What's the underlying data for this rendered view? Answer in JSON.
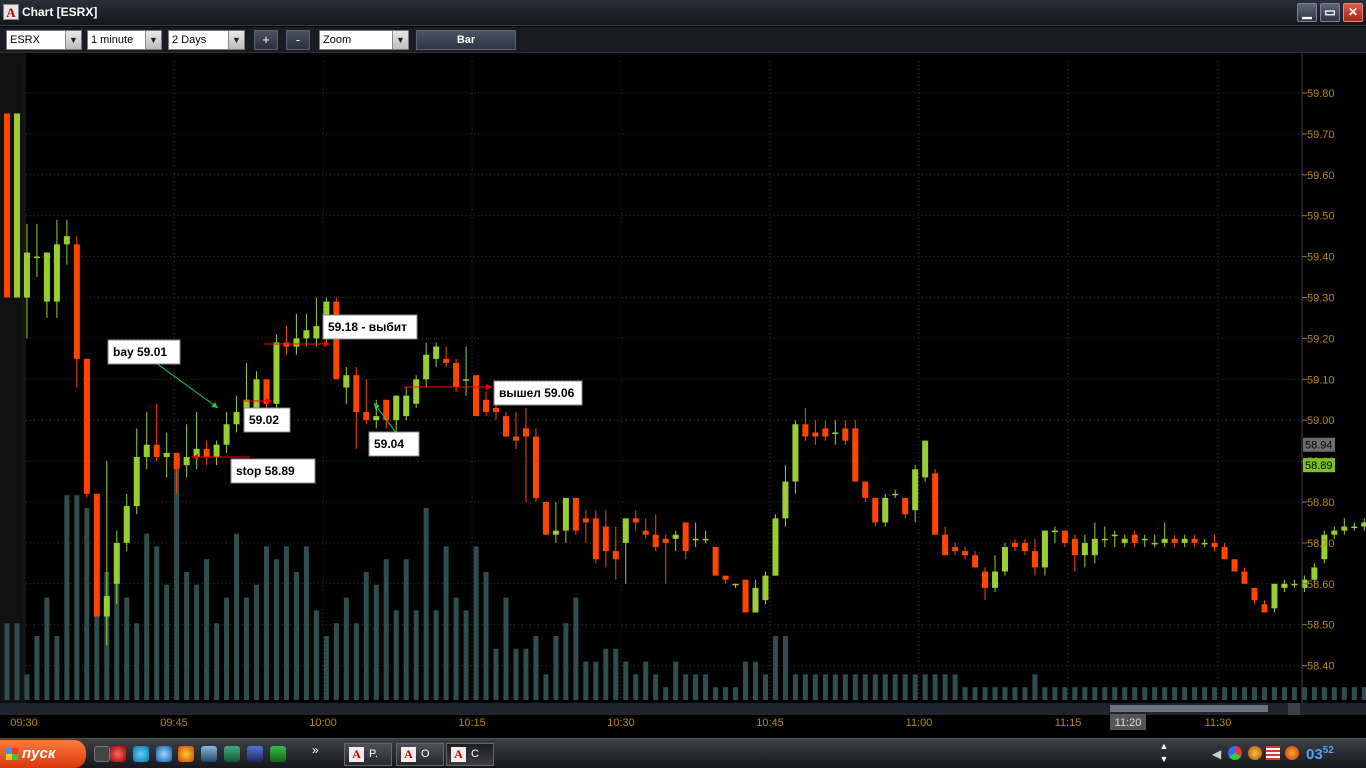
{
  "window": {
    "title": "Chart [ESRX]",
    "minimize": "▁",
    "maximize": "▭",
    "close": "✕"
  },
  "toolbar": {
    "symbol": "ESRX",
    "interval": "1 minute",
    "range": "2 Days",
    "zoom_in": "+",
    "zoom_out": "-",
    "zoom_mode": "Zoom",
    "chart_type_button": "Bar"
  },
  "chart_data": {
    "type": "candlestick",
    "symbol": "ESRX",
    "interval": "1 minute",
    "ylim": [
      58.3,
      59.86
    ],
    "y_ticks": [
      "59.80",
      "59.70",
      "59.60",
      "59.50",
      "59.40",
      "59.30",
      "59.20",
      "59.10",
      "59.00",
      "58.90",
      "58.80",
      "58.70",
      "58.60",
      "58.50",
      "58.40"
    ],
    "x_ticks": [
      "09:30",
      "09:45",
      "10:00",
      "10:15",
      "10:30",
      "10:45",
      "11:00",
      "11:15",
      "11:20",
      "11:30"
    ],
    "cursor_time_label": "11:20",
    "price_labels": [
      {
        "text": "58.94",
        "value": 58.94,
        "color": "#6e6e6e"
      },
      {
        "text": "58.89",
        "value": 58.89,
        "color": "#7cc223"
      }
    ],
    "colors": {
      "up": "#9acd32",
      "down": "#ff4500",
      "volume": "#2f4f4f",
      "grid": "#3a3a3a",
      "axis_text": "#b8860b"
    },
    "candles": [
      {
        "o": 59.75,
        "h": 59.75,
        "l": 59.3,
        "c": 59.3
      },
      {
        "o": 59.3,
        "h": 59.75,
        "l": 59.3,
        "c": 59.75
      },
      {
        "o": 59.3,
        "h": 59.48,
        "l": 59.2,
        "c": 59.41
      },
      {
        "o": 59.4,
        "h": 59.48,
        "l": 59.35,
        "c": 59.4
      },
      {
        "o": 59.29,
        "h": 59.41,
        "l": 59.25,
        "c": 59.41
      },
      {
        "o": 59.29,
        "h": 59.49,
        "l": 59.25,
        "c": 59.43
      },
      {
        "o": 59.43,
        "h": 59.49,
        "l": 59.38,
        "c": 59.45
      },
      {
        "o": 59.43,
        "h": 59.45,
        "l": 59.08,
        "c": 59.15
      },
      {
        "o": 59.15,
        "h": 59.15,
        "l": 58.81,
        "c": 58.82
      },
      {
        "o": 58.82,
        "h": 58.82,
        "l": 58.52,
        "c": 58.52
      },
      {
        "o": 58.52,
        "h": 58.9,
        "l": 58.45,
        "c": 58.57
      },
      {
        "o": 58.6,
        "h": 58.73,
        "l": 58.55,
        "c": 58.7
      },
      {
        "o": 58.7,
        "h": 58.82,
        "l": 58.68,
        "c": 58.79
      },
      {
        "o": 58.79,
        "h": 58.98,
        "l": 58.77,
        "c": 58.91
      },
      {
        "o": 58.91,
        "h": 59.02,
        "l": 58.88,
        "c": 58.94
      },
      {
        "o": 58.94,
        "h": 59.04,
        "l": 58.9,
        "c": 58.91
      },
      {
        "o": 58.91,
        "h": 58.97,
        "l": 58.86,
        "c": 58.92
      },
      {
        "o": 58.92,
        "h": 58.92,
        "l": 58.82,
        "c": 58.88
      },
      {
        "o": 58.89,
        "h": 58.99,
        "l": 58.86,
        "c": 58.91
      },
      {
        "o": 58.91,
        "h": 59.02,
        "l": 58.88,
        "c": 58.93
      },
      {
        "o": 58.93,
        "h": 58.95,
        "l": 58.89,
        "c": 58.91
      },
      {
        "o": 58.91,
        "h": 58.95,
        "l": 58.89,
        "c": 58.94
      },
      {
        "o": 58.94,
        "h": 59.02,
        "l": 58.92,
        "c": 58.99
      },
      {
        "o": 58.99,
        "h": 59.06,
        "l": 58.97,
        "c": 59.02
      },
      {
        "o": 59.02,
        "h": 59.14,
        "l": 58.98,
        "c": 59.05
      },
      {
        "o": 59.02,
        "h": 59.12,
        "l": 59.0,
        "c": 59.1
      },
      {
        "o": 59.1,
        "h": 59.1,
        "l": 59.03,
        "c": 59.04
      },
      {
        "o": 59.04,
        "h": 59.21,
        "l": 59.02,
        "c": 59.19
      },
      {
        "o": 59.19,
        "h": 59.23,
        "l": 59.16,
        "c": 59.18
      },
      {
        "o": 59.18,
        "h": 59.26,
        "l": 59.16,
        "c": 59.2
      },
      {
        "o": 59.2,
        "h": 59.26,
        "l": 59.18,
        "c": 59.22
      },
      {
        "o": 59.2,
        "h": 59.3,
        "l": 59.18,
        "c": 59.23
      },
      {
        "o": 59.2,
        "h": 59.3,
        "l": 59.19,
        "c": 59.29
      },
      {
        "o": 59.29,
        "h": 59.3,
        "l": 59.18,
        "c": 59.1
      },
      {
        "o": 59.08,
        "h": 59.13,
        "l": 59.04,
        "c": 59.11
      },
      {
        "o": 59.11,
        "h": 59.13,
        "l": 58.93,
        "c": 59.02
      },
      {
        "o": 59.02,
        "h": 59.1,
        "l": 58.99,
        "c": 59.0
      },
      {
        "o": 59.0,
        "h": 59.05,
        "l": 58.98,
        "c": 59.01
      },
      {
        "o": 59.05,
        "h": 59.05,
        "l": 58.98,
        "c": 59.0
      },
      {
        "o": 59.0,
        "h": 59.06,
        "l": 58.97,
        "c": 59.06
      },
      {
        "o": 59.01,
        "h": 59.08,
        "l": 59.0,
        "c": 59.06
      },
      {
        "o": 59.04,
        "h": 59.11,
        "l": 59.03,
        "c": 59.1
      },
      {
        "o": 59.1,
        "h": 59.19,
        "l": 59.08,
        "c": 59.16
      },
      {
        "o": 59.15,
        "h": 59.19,
        "l": 59.13,
        "c": 59.18
      },
      {
        "o": 59.15,
        "h": 59.18,
        "l": 59.13,
        "c": 59.14
      },
      {
        "o": 59.14,
        "h": 59.15,
        "l": 59.07,
        "c": 59.08
      },
      {
        "o": 59.1,
        "h": 59.18,
        "l": 59.06,
        "c": 59.1
      },
      {
        "o": 59.11,
        "h": 59.11,
        "l": 59.01,
        "c": 59.01
      },
      {
        "o": 59.05,
        "h": 59.07,
        "l": 59.01,
        "c": 59.02
      },
      {
        "o": 59.03,
        "h": 59.04,
        "l": 59.0,
        "c": 59.02
      },
      {
        "o": 59.01,
        "h": 59.02,
        "l": 58.96,
        "c": 58.96
      },
      {
        "o": 58.96,
        "h": 59.02,
        "l": 58.93,
        "c": 58.95
      },
      {
        "o": 58.98,
        "h": 59.03,
        "l": 58.8,
        "c": 58.96
      },
      {
        "o": 58.96,
        "h": 58.98,
        "l": 58.8,
        "c": 58.81
      },
      {
        "o": 58.8,
        "h": 58.8,
        "l": 58.72,
        "c": 58.72
      },
      {
        "o": 58.72,
        "h": 58.8,
        "l": 58.7,
        "c": 58.73
      },
      {
        "o": 58.73,
        "h": 58.81,
        "l": 58.7,
        "c": 58.81
      },
      {
        "o": 58.81,
        "h": 58.81,
        "l": 58.72,
        "c": 58.73
      },
      {
        "o": 58.76,
        "h": 58.78,
        "l": 58.7,
        "c": 58.75
      },
      {
        "o": 58.76,
        "h": 58.78,
        "l": 58.65,
        "c": 58.66
      },
      {
        "o": 58.74,
        "h": 58.78,
        "l": 58.64,
        "c": 58.68
      },
      {
        "o": 58.68,
        "h": 58.74,
        "l": 58.61,
        "c": 58.66
      },
      {
        "o": 58.7,
        "h": 58.76,
        "l": 58.6,
        "c": 58.76
      },
      {
        "o": 58.76,
        "h": 58.78,
        "l": 58.73,
        "c": 58.75
      },
      {
        "o": 58.73,
        "h": 58.76,
        "l": 58.71,
        "c": 58.72
      },
      {
        "o": 58.72,
        "h": 58.77,
        "l": 58.68,
        "c": 58.69
      },
      {
        "o": 58.71,
        "h": 58.72,
        "l": 58.6,
        "c": 58.7
      },
      {
        "o": 58.71,
        "h": 58.73,
        "l": 58.68,
        "c": 58.72
      },
      {
        "o": 58.75,
        "h": 58.75,
        "l": 58.66,
        "c": 58.68
      },
      {
        "o": 58.71,
        "h": 58.75,
        "l": 58.69,
        "c": 58.71
      },
      {
        "o": 58.71,
        "h": 58.73,
        "l": 58.7,
        "c": 58.71
      },
      {
        "o": 58.69,
        "h": 58.69,
        "l": 58.62,
        "c": 58.62
      },
      {
        "o": 58.62,
        "h": 58.62,
        "l": 58.6,
        "c": 58.61
      },
      {
        "o": 58.6,
        "h": 58.6,
        "l": 58.59,
        "c": 58.6
      },
      {
        "o": 58.61,
        "h": 58.61,
        "l": 58.53,
        "c": 58.53
      },
      {
        "o": 58.53,
        "h": 58.61,
        "l": 58.53,
        "c": 58.59
      },
      {
        "o": 58.56,
        "h": 58.63,
        "l": 58.55,
        "c": 58.62
      },
      {
        "o": 58.62,
        "h": 58.77,
        "l": 58.62,
        "c": 58.76
      },
      {
        "o": 58.76,
        "h": 58.89,
        "l": 58.74,
        "c": 58.85
      },
      {
        "o": 58.85,
        "h": 59.0,
        "l": 58.82,
        "c": 58.99
      },
      {
        "o": 58.99,
        "h": 59.03,
        "l": 58.95,
        "c": 58.96
      },
      {
        "o": 58.97,
        "h": 59.0,
        "l": 58.94,
        "c": 58.96
      },
      {
        "o": 58.98,
        "h": 59.0,
        "l": 58.95,
        "c": 58.96
      },
      {
        "o": 58.97,
        "h": 59.0,
        "l": 58.94,
        "c": 58.97
      },
      {
        "o": 58.98,
        "h": 59.0,
        "l": 58.94,
        "c": 58.95
      },
      {
        "o": 58.98,
        "h": 59.0,
        "l": 58.85,
        "c": 58.85
      },
      {
        "o": 58.85,
        "h": 58.85,
        "l": 58.8,
        "c": 58.81
      },
      {
        "o": 58.81,
        "h": 58.81,
        "l": 58.74,
        "c": 58.75
      },
      {
        "o": 58.75,
        "h": 58.82,
        "l": 58.74,
        "c": 58.81
      },
      {
        "o": 58.82,
        "h": 58.83,
        "l": 58.81,
        "c": 58.82
      },
      {
        "o": 58.81,
        "h": 58.81,
        "l": 58.76,
        "c": 58.77
      },
      {
        "o": 58.78,
        "h": 58.89,
        "l": 58.75,
        "c": 58.88
      },
      {
        "o": 58.86,
        "h": 58.95,
        "l": 58.85,
        "c": 58.95
      },
      {
        "o": 58.87,
        "h": 58.88,
        "l": 58.72,
        "c": 58.72
      },
      {
        "o": 58.72,
        "h": 58.74,
        "l": 58.67,
        "c": 58.67
      },
      {
        "o": 58.69,
        "h": 58.7,
        "l": 58.67,
        "c": 58.68
      },
      {
        "o": 58.68,
        "h": 58.69,
        "l": 58.66,
        "c": 58.67
      },
      {
        "o": 58.67,
        "h": 58.68,
        "l": 58.64,
        "c": 58.64
      },
      {
        "o": 58.63,
        "h": 58.64,
        "l": 58.56,
        "c": 58.59
      },
      {
        "o": 58.59,
        "h": 58.67,
        "l": 58.58,
        "c": 58.63
      },
      {
        "o": 58.63,
        "h": 58.7,
        "l": 58.62,
        "c": 58.69
      },
      {
        "o": 58.7,
        "h": 58.71,
        "l": 58.68,
        "c": 58.69
      },
      {
        "o": 58.7,
        "h": 58.71,
        "l": 58.67,
        "c": 58.68
      },
      {
        "o": 58.68,
        "h": 58.71,
        "l": 58.62,
        "c": 58.64
      },
      {
        "o": 58.64,
        "h": 58.73,
        "l": 58.62,
        "c": 58.73
      },
      {
        "o": 58.73,
        "h": 58.74,
        "l": 58.7,
        "c": 58.73
      },
      {
        "o": 58.73,
        "h": 58.73,
        "l": 58.69,
        "c": 58.7
      },
      {
        "o": 58.71,
        "h": 58.72,
        "l": 58.63,
        "c": 58.67
      },
      {
        "o": 58.67,
        "h": 58.72,
        "l": 58.64,
        "c": 58.7
      },
      {
        "o": 58.67,
        "h": 58.75,
        "l": 58.65,
        "c": 58.71
      },
      {
        "o": 58.71,
        "h": 58.74,
        "l": 58.69,
        "c": 58.71
      },
      {
        "o": 58.72,
        "h": 58.73,
        "l": 58.69,
        "c": 58.72
      },
      {
        "o": 58.7,
        "h": 58.72,
        "l": 58.69,
        "c": 58.71
      },
      {
        "o": 58.72,
        "h": 58.73,
        "l": 58.69,
        "c": 58.7
      },
      {
        "o": 58.71,
        "h": 58.72,
        "l": 58.69,
        "c": 58.71
      },
      {
        "o": 58.7,
        "h": 58.72,
        "l": 58.69,
        "c": 58.7
      },
      {
        "o": 58.7,
        "h": 58.75,
        "l": 58.69,
        "c": 58.71
      },
      {
        "o": 58.71,
        "h": 58.72,
        "l": 58.69,
        "c": 58.7
      },
      {
        "o": 58.7,
        "h": 58.72,
        "l": 58.69,
        "c": 58.71
      },
      {
        "o": 58.71,
        "h": 58.72,
        "l": 58.69,
        "c": 58.7
      },
      {
        "o": 58.7,
        "h": 58.71,
        "l": 58.69,
        "c": 58.7
      },
      {
        "o": 58.7,
        "h": 58.72,
        "l": 58.68,
        "c": 58.69
      },
      {
        "o": 58.69,
        "h": 58.7,
        "l": 58.66,
        "c": 58.66
      },
      {
        "o": 58.66,
        "h": 58.66,
        "l": 58.63,
        "c": 58.63
      },
      {
        "o": 58.63,
        "h": 58.64,
        "l": 58.6,
        "c": 58.6
      },
      {
        "o": 58.59,
        "h": 58.59,
        "l": 58.55,
        "c": 58.56
      },
      {
        "o": 58.55,
        "h": 58.56,
        "l": 58.53,
        "c": 58.53
      },
      {
        "o": 58.54,
        "h": 58.6,
        "l": 58.53,
        "c": 58.6
      },
      {
        "o": 58.59,
        "h": 58.61,
        "l": 58.58,
        "c": 58.6
      },
      {
        "o": 58.6,
        "h": 58.61,
        "l": 58.59,
        "c": 58.6
      },
      {
        "o": 58.59,
        "h": 58.62,
        "l": 58.58,
        "c": 58.61
      },
      {
        "o": 58.61,
        "h": 58.65,
        "l": 58.6,
        "c": 58.64
      },
      {
        "o": 58.66,
        "h": 58.73,
        "l": 58.65,
        "c": 58.72
      },
      {
        "o": 58.72,
        "h": 58.74,
        "l": 58.71,
        "c": 58.73
      },
      {
        "o": 58.73,
        "h": 58.76,
        "l": 58.72,
        "c": 58.74
      },
      {
        "o": 58.74,
        "h": 58.75,
        "l": 58.73,
        "c": 58.74
      },
      {
        "o": 58.74,
        "h": 58.76,
        "l": 58.73,
        "c": 58.75
      },
      {
        "o": 58.73,
        "h": 58.76,
        "l": 58.72,
        "c": 58.74
      },
      {
        "o": 58.75,
        "h": 58.85,
        "l": 58.74,
        "c": 58.84
      },
      {
        "o": 58.84,
        "h": 58.89,
        "l": 58.82,
        "c": 58.87
      },
      {
        "o": 58.85,
        "h": 58.91,
        "l": 58.84,
        "c": 58.89
      },
      {
        "o": 58.85,
        "h": 58.87,
        "l": 58.84,
        "c": 58.86
      },
      {
        "o": 58.86,
        "h": 58.87,
        "l": 58.8,
        "c": 58.8
      }
    ],
    "volume": [
      6,
      6,
      2,
      5,
      8,
      5,
      16,
      16,
      15,
      12,
      10,
      10,
      8,
      6,
      13,
      12,
      9,
      18,
      10,
      9,
      11,
      6,
      8,
      13,
      8,
      9,
      12,
      11,
      12,
      10,
      12,
      7,
      5,
      6,
      8,
      6,
      10,
      9,
      11,
      7,
      11,
      7,
      15,
      7,
      12,
      8,
      7,
      12,
      10,
      4,
      8,
      4,
      4,
      5,
      2,
      5,
      6,
      8,
      3,
      3,
      4,
      4,
      3,
      2,
      3,
      2,
      1,
      3,
      2,
      2,
      2,
      1,
      1,
      1,
      3,
      3,
      2,
      5,
      5,
      2,
      2,
      2,
      2,
      2,
      2,
      2,
      2,
      2,
      2,
      2,
      2,
      2,
      2,
      2,
      2,
      2,
      1,
      1,
      1,
      1,
      1,
      1,
      1,
      2,
      1,
      1,
      1,
      1,
      1,
      1,
      1,
      1,
      1,
      1,
      1,
      1,
      1,
      1,
      1,
      1,
      1,
      1,
      1,
      1,
      1,
      1,
      1,
      1,
      1,
      1,
      1,
      1,
      1,
      1,
      1,
      1,
      1,
      1,
      1,
      1,
      1,
      1,
      1,
      1,
      1,
      1,
      1
    ],
    "annotations": [
      {
        "text": "bay 59.01",
        "kind": "label",
        "arrow_color": "#22cc44"
      },
      {
        "text": "59.02",
        "kind": "label",
        "arrow_color": "#ff0000"
      },
      {
        "text": "stop 58.89",
        "kind": "label",
        "arrow_color": "#ff0000"
      },
      {
        "text": "59.18 - выбит",
        "kind": "label",
        "arrow_color": "#ff0000"
      },
      {
        "text": "59.04",
        "kind": "label",
        "arrow_color": "#22cc44"
      },
      {
        "text": "вышел 59.06",
        "kind": "label",
        "arrow_color": "#ff0000"
      }
    ]
  },
  "taskbar": {
    "start_label": "пуск",
    "tasks": [
      {
        "label": "P."
      },
      {
        "label": "O"
      },
      {
        "label": "C"
      }
    ],
    "clock": "03",
    "clock_sub": "52"
  }
}
